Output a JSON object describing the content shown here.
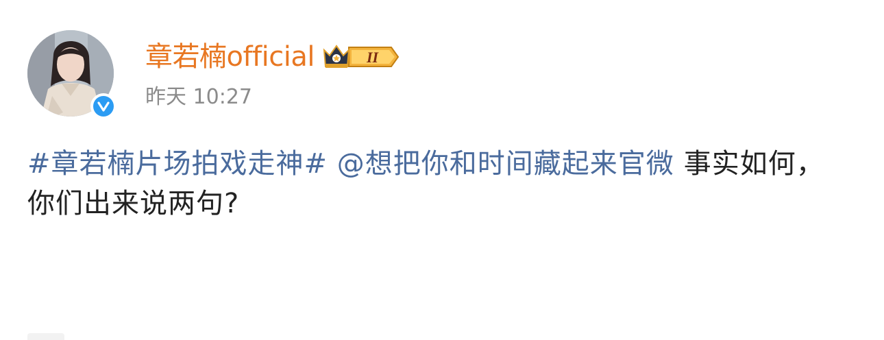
{
  "post": {
    "author": {
      "name": "章若楠official",
      "verified_color": "#2c9cf3",
      "name_color": "#e87722",
      "badge_level": "II",
      "avatar_icon": "avatar-photo"
    },
    "timestamp": "昨天 10:27",
    "content": {
      "hashtag": "#章若楠片场拍戏走神#",
      "mention": "@想把你和时间藏起来官微",
      "text": "事实如何，你们出来说两句?"
    },
    "link_color": "#4a6b9d"
  }
}
